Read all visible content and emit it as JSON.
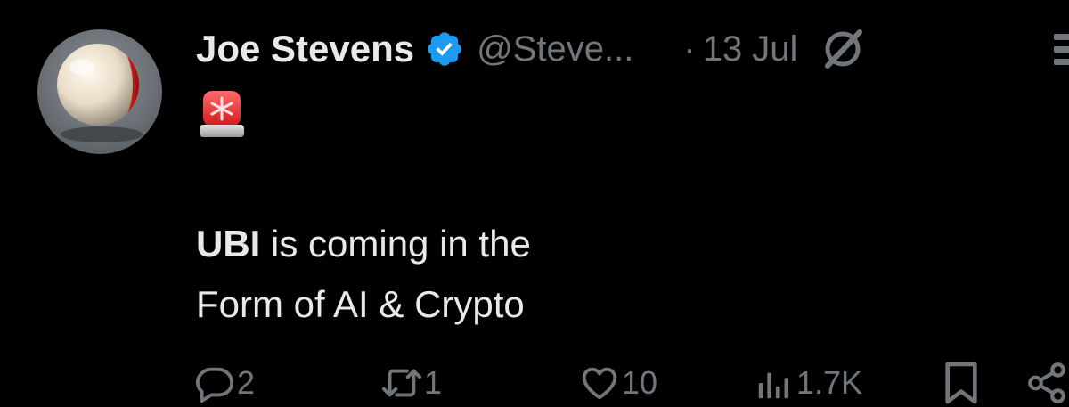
{
  "tweet": {
    "author": {
      "display_name": "Joe Stevens",
      "verified": true,
      "handle": "@Steve..."
    },
    "separator": "·",
    "date": "13 Jul",
    "emoji": "🚨",
    "text_bold": "UBI",
    "text_line1_rest": " is coming in the",
    "text_line2": "Form of AI & Crypto",
    "icons": {
      "verified": "verified-badge-icon",
      "grok": "grok-icon",
      "more": "more-icon"
    }
  },
  "actions": {
    "replies": {
      "icon": "reply-icon",
      "count": "2"
    },
    "reposts": {
      "icon": "repost-icon",
      "count": "1"
    },
    "likes": {
      "icon": "heart-icon",
      "count": "10"
    },
    "views": {
      "icon": "views-icon",
      "count": "1.7K"
    },
    "bookmark": {
      "icon": "bookmark-icon"
    },
    "share": {
      "icon": "share-icon"
    }
  },
  "colors": {
    "background": "#000000",
    "text_primary": "#e7e9ea",
    "text_secondary": "#71767b",
    "verified_blue": "#1d9bf0"
  }
}
